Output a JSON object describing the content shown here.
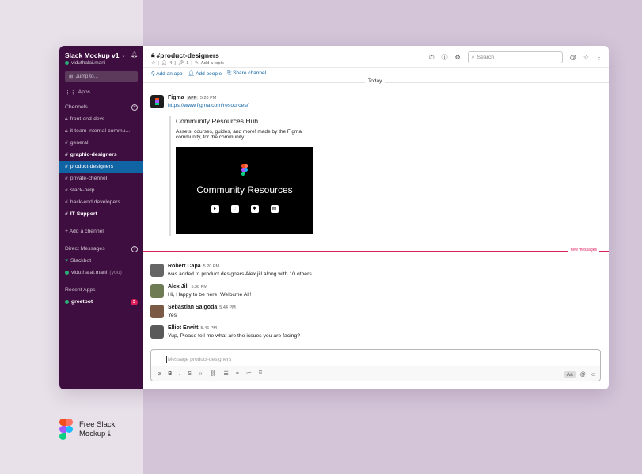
{
  "sidebar": {
    "workspace": "Slack Mockup v1",
    "user": "viduthalai.mani",
    "jump": "Jump to...",
    "apps": "Apps",
    "channels_header": "Chennels",
    "channels": [
      {
        "label": "front-end-devs",
        "locked": true
      },
      {
        "label": "it-team-internal-commu...",
        "locked": true
      },
      {
        "label": "general"
      },
      {
        "label": "graphic-designers",
        "bold": true
      },
      {
        "label": "product-designers",
        "active": true
      },
      {
        "label": "private-chennel"
      },
      {
        "label": "slack-help"
      },
      {
        "label": "back-end developers"
      },
      {
        "label": "IT Support",
        "bold": true
      }
    ],
    "add_channel": "+ Add a chennel",
    "dm_header": "Direct Messages",
    "dms": [
      {
        "label": "Slackbot",
        "icon": "heart-icon"
      },
      {
        "label": "viduthalai.mani",
        "suffix": "(you)"
      }
    ],
    "recent_header": "Recent Apps",
    "recent": [
      {
        "label": "greetbot",
        "badge": "3"
      }
    ]
  },
  "header": {
    "channel": "#product-designers",
    "members": "4",
    "pins": "1",
    "add_topic": "Add a topic",
    "search_placeholder": "Search"
  },
  "bookmarks": [
    "Add an app",
    "Add people",
    "Share channel"
  ],
  "divider": "Today",
  "new_messages": "new messages",
  "messages": [
    {
      "name": "Figma",
      "tag": "APP",
      "time": "5.20 PM",
      "text": "https://www.figma.com/resources/"
    },
    {
      "name": "Robert Capa",
      "time": "5.20 PM",
      "text": "was added to product designers Alex jill along with 10 others."
    },
    {
      "name": "Alex Jill",
      "time": "5.38 PM",
      "text": "Hi, Happy to be here! Welocme All!"
    },
    {
      "name": "Sebastian Salgoda",
      "time": "5.44 PM",
      "text": "Yes"
    },
    {
      "name": "Elliot Erwitt",
      "time": "5.46 PM",
      "text": "Yup, Please tell me what are the issues you are facing?"
    }
  ],
  "attachment": {
    "title": "Community Resources Hub",
    "desc": "Assets, courses, guides, and more! made by the Figma community, for the community.",
    "image_text": "Community Resources"
  },
  "composer": {
    "placeholder": "Message product-designers",
    "aa": "Aa"
  },
  "footer": {
    "line1": "Free Slack",
    "line2": "Mockup"
  }
}
